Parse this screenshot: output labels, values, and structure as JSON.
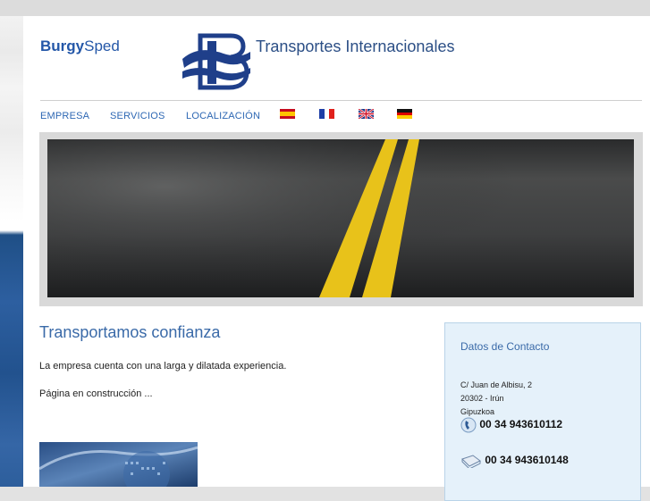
{
  "header": {
    "brand_part1": "Burgy",
    "brand_part2": "Sped",
    "logo_icon": "bs-logo-icon",
    "tagline": "Transportes Internacionales"
  },
  "nav": {
    "items": [
      "EMPRESA",
      "SERVICIOS",
      "LOCALIZACIÓN"
    ],
    "flags": [
      "spain-flag-icon",
      "france-flag-icon",
      "uk-flag-icon",
      "germany-flag-icon"
    ]
  },
  "main": {
    "heading": "Transportamos confianza",
    "paragraph1": "La empresa cuenta con una larga y dilatada experiencia.",
    "paragraph2": "Página en construcción ..."
  },
  "contact": {
    "title": "Datos de Contacto",
    "address_line1": "C/ Juan de Albisu, 2",
    "address_line2": "20302 - Irún",
    "address_line3": "Gipuzkoa",
    "phone": "00 34 943610112",
    "fax": "00 34 943610148"
  },
  "colors": {
    "brand_blue": "#2457a8",
    "link_blue": "#2d67b3",
    "heading_blue": "#3a6aa8",
    "contact_bg": "#e5f1fa"
  }
}
